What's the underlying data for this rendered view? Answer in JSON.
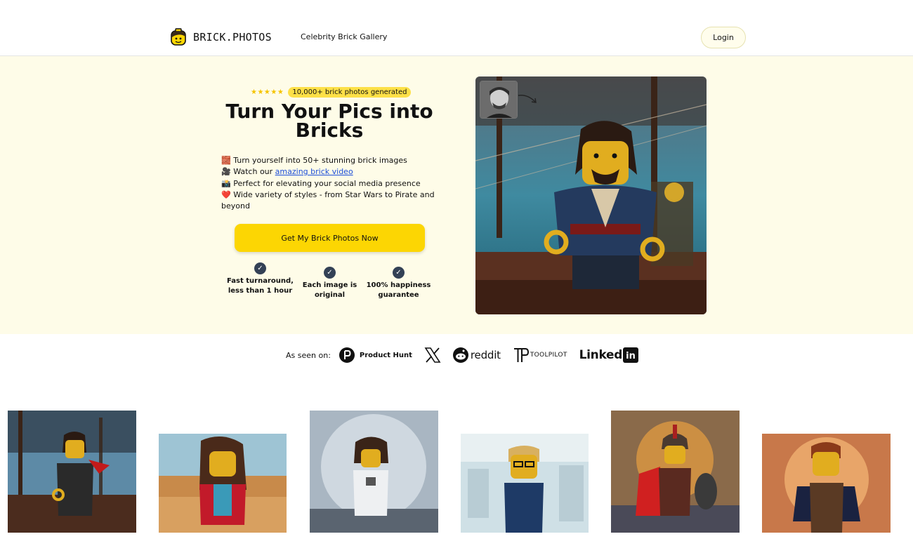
{
  "header": {
    "logo_text": "BRICK.PHOTOS",
    "nav_link": "Celebrity Brick Gallery",
    "login_label": "Login"
  },
  "hero": {
    "stars": "★★★★★",
    "badge": "10,000+ brick photos generated",
    "title": "Turn Your Pics into Bricks",
    "features": [
      {
        "emoji": "🧱",
        "text": "Turn yourself into 50+ stunning brick images"
      },
      {
        "emoji": "🎥",
        "text_before": "Watch our ",
        "link": "amazing brick video"
      },
      {
        "emoji": "📸",
        "text": "Perfect for elevating your social media presence"
      },
      {
        "emoji": "❤️",
        "text": "Wide variety of styles - from Star Wars to Pirate and beyond"
      }
    ],
    "cta_label": "Get My Brick Photos Now",
    "guarantees": [
      "Fast turnaround, less than 1 hour",
      "Each image is original",
      "100% happiness guarantee"
    ],
    "check_icon": "✓"
  },
  "seen_on": {
    "label": "As seen on:",
    "brands": [
      "Product Hunt",
      "X",
      "reddit",
      "TOOLPILOT",
      "LinkedIn"
    ]
  },
  "gallery": {
    "count": 6,
    "images": [
      "pirate-minifigure",
      "beach-minifigure",
      "astronaut-minifigure",
      "doctor-minifigure",
      "gladiator-minifigure",
      "caped-minifigure"
    ]
  },
  "colors": {
    "hero_bg": "#fefce8",
    "cta": "#fcd603",
    "badge": "#fde047",
    "link": "#1d4ed8",
    "check": "#334155"
  }
}
